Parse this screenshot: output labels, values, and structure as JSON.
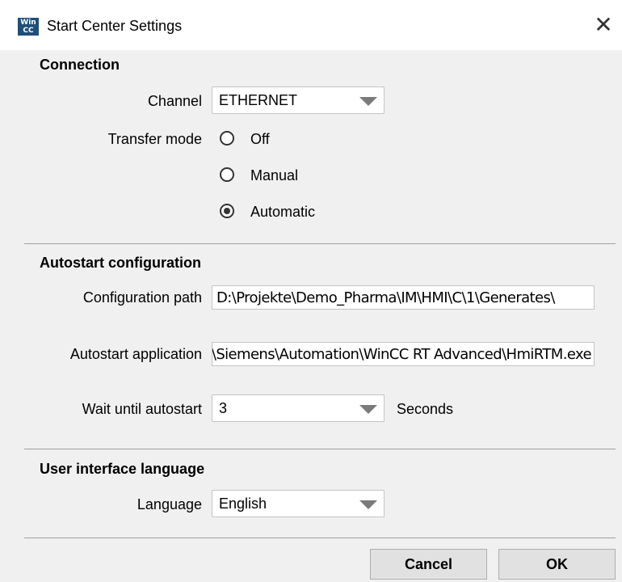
{
  "window": {
    "title": "Start Center Settings",
    "app_icon_text": "WinCC"
  },
  "connection": {
    "section_title": "Connection",
    "channel_label": "Channel",
    "channel_value": "ETHERNET",
    "transfer_mode_label": "Transfer mode",
    "options": [
      "Off",
      "Manual",
      "Automatic"
    ],
    "selected_option": "Automatic"
  },
  "autostart": {
    "section_title": "Autostart configuration",
    "config_path_label": "Configuration path",
    "config_path_value": "D:\\Projekte\\Demo_Pharma\\IM\\HMI\\C\\1\\Generates\\",
    "app_label": "Autostart application",
    "app_value": "C:\\Program Files\\Siemens\\Automation\\WinCC RT Advanced\\HmiRTM.exe",
    "wait_label": "Wait until autostart",
    "wait_value": "3",
    "wait_unit": "Seconds"
  },
  "language": {
    "section_title": "User interface language",
    "label": "Language",
    "value": "English"
  },
  "buttons": {
    "cancel": "Cancel",
    "ok": "OK"
  },
  "icons": {
    "app": "wincc-app-icon",
    "close": "close-icon",
    "dropdown": "dropdown-arrow-icon"
  }
}
